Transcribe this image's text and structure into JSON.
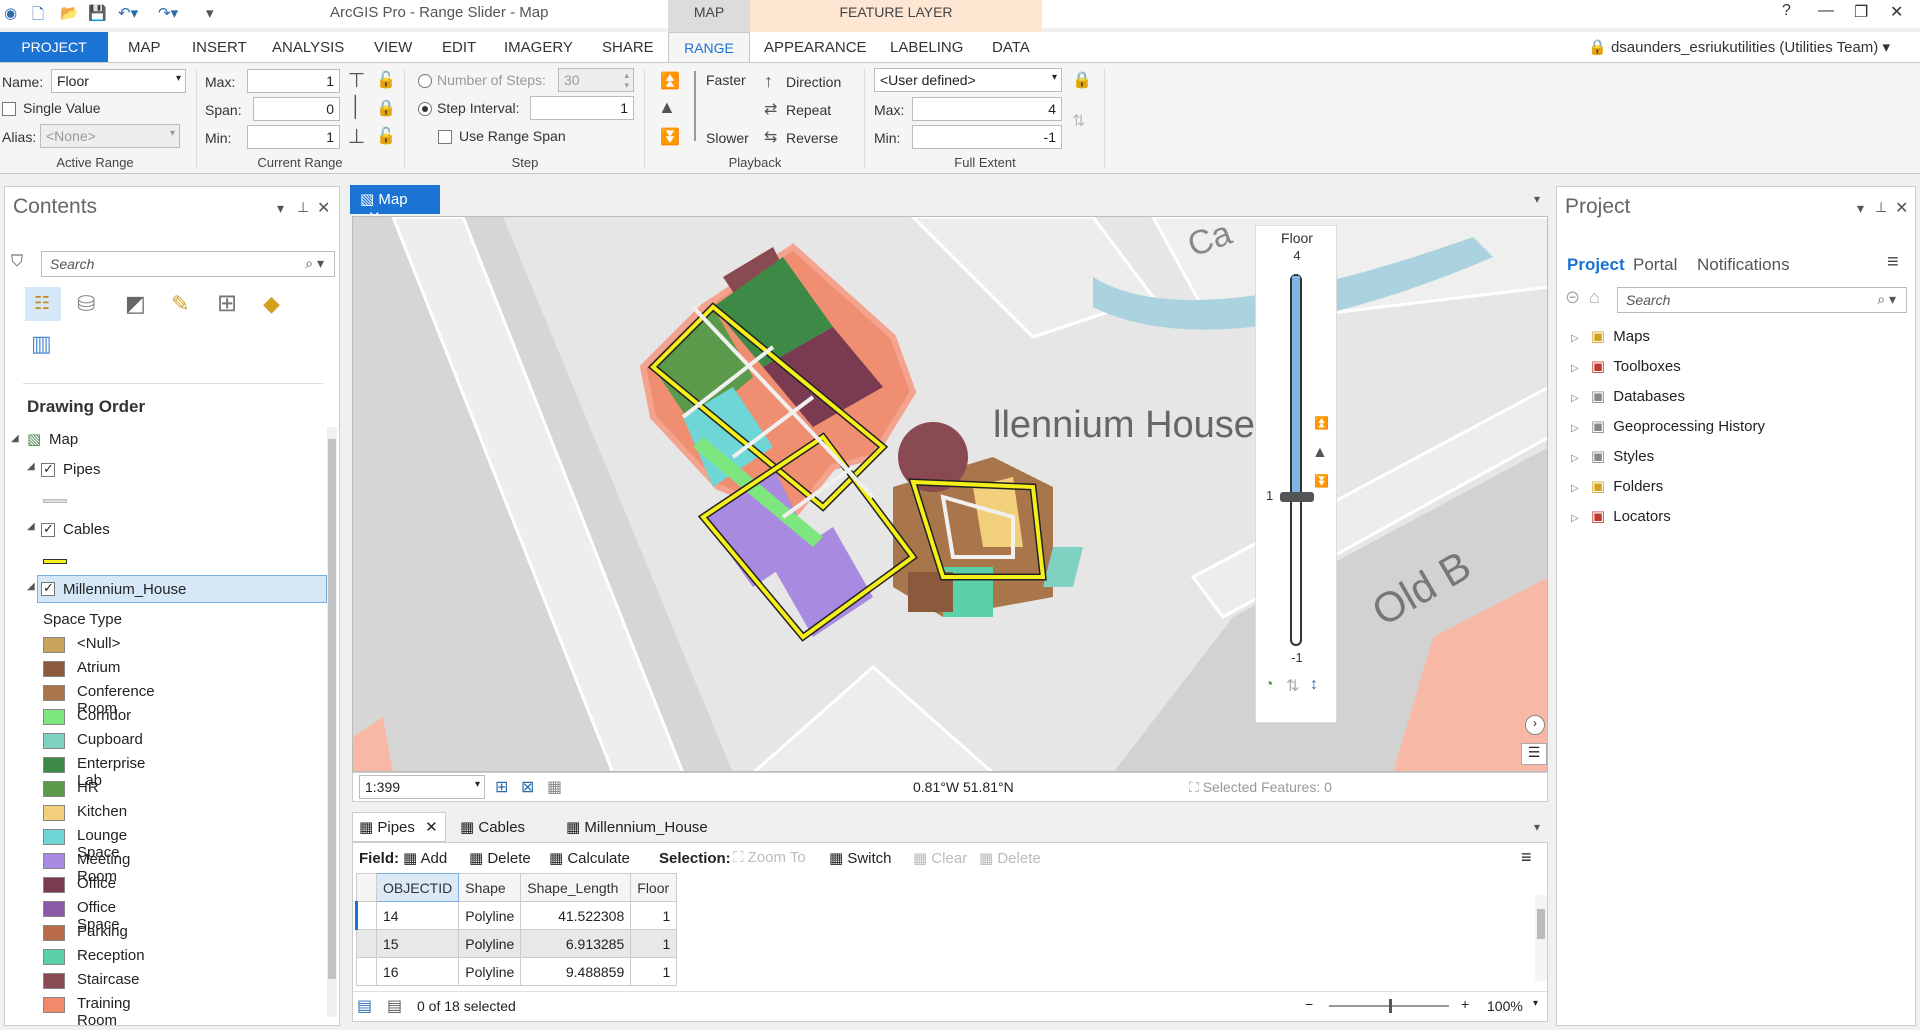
{
  "app": {
    "title": "ArcGIS Pro - Range Slider - Map",
    "context_map": "MAP",
    "context_feature_layer": "FEATURE LAYER",
    "user": "dsaunders_esriukutilities (Utilities Team)"
  },
  "tabs": [
    "PROJECT",
    "MAP",
    "INSERT",
    "ANALYSIS",
    "VIEW",
    "EDIT",
    "IMAGERY",
    "SHARE",
    "RANGE",
    "APPEARANCE",
    "LABELING",
    "DATA"
  ],
  "ribbon": {
    "active_range": {
      "name_label": "Name:",
      "name_value": "Floor",
      "single_value": "Single Value",
      "alias_label": "Alias:",
      "alias_value": "<None>",
      "group": "Active Range"
    },
    "current_range": {
      "max_label": "Max:",
      "max_value": "1",
      "span_label": "Span:",
      "span_value": "0",
      "min_label": "Min:",
      "min_value": "1",
      "group": "Current Range"
    },
    "step": {
      "num_steps_label": "Number of Steps:",
      "num_steps_value": "30",
      "step_interval_label": "Step Interval:",
      "step_interval_value": "1",
      "use_range_span": "Use Range Span",
      "group": "Step"
    },
    "playback": {
      "faster": "Faster",
      "slower": "Slower",
      "direction": "Direction",
      "repeat": "Repeat",
      "reverse": "Reverse",
      "group": "Playback"
    },
    "full_extent": {
      "mode": "<User defined>",
      "max_label": "Max:",
      "max_value": "4",
      "min_label": "Min:",
      "min_value": "-1",
      "group": "Full Extent"
    }
  },
  "contents": {
    "title": "Contents",
    "search_placeholder": "Search",
    "drawing_order": "Drawing Order",
    "layers": {
      "map": "Map",
      "pipes": "Pipes",
      "cables": "Cables",
      "millennium": "Millennium_House"
    },
    "space_type_label": "Space Type",
    "legend": [
      {
        "label": "<Null>",
        "color": "#c8a35a"
      },
      {
        "label": "Atrium",
        "color": "#8b5a3c"
      },
      {
        "label": "Conference Room",
        "color": "#a8764a"
      },
      {
        "label": "Corridor",
        "color": "#7ee67e"
      },
      {
        "label": "Cupboard",
        "color": "#7fd1c1"
      },
      {
        "label": "Enterprise Lab",
        "color": "#3d8a47"
      },
      {
        "label": "HR",
        "color": "#5a9a4a"
      },
      {
        "label": "Kitchen",
        "color": "#f2cf7a"
      },
      {
        "label": "Lounge Space",
        "color": "#6fd6d6"
      },
      {
        "label": "Meeting Room",
        "color": "#a88ae0"
      },
      {
        "label": "Office",
        "color": "#7a3a52"
      },
      {
        "label": "Office Space",
        "color": "#8a5aa8"
      },
      {
        "label": "Parking",
        "color": "#b86a4a"
      },
      {
        "label": "Reception",
        "color": "#5ad1a8"
      },
      {
        "label": "Staircase",
        "color": "#8a4a52"
      },
      {
        "label": "Training Room",
        "color": "#f08a6a"
      }
    ]
  },
  "map": {
    "tab": "Map",
    "label_building": "llennium House",
    "label_street": "Old B",
    "label_top": "Ca",
    "scale": "1:399",
    "coords": "0.81°W 51.81°N",
    "selected_features": "Selected Features: 0"
  },
  "slider": {
    "label": "Floor",
    "max": "4",
    "current": "1",
    "min": "-1",
    "level_fraction": 0.4
  },
  "project_pane": {
    "title": "Project",
    "tabs": [
      "Project",
      "Portal",
      "Notifications"
    ],
    "search_placeholder": "Search",
    "items": [
      "Maps",
      "Toolboxes",
      "Databases",
      "Geoprocessing History",
      "Styles",
      "Folders",
      "Locators"
    ]
  },
  "table": {
    "tabs": [
      "Pipes",
      "Cables",
      "Millennium_House"
    ],
    "field_label": "Field:",
    "add": "Add",
    "delete": "Delete",
    "calculate": "Calculate",
    "selection_label": "Selection:",
    "zoom_to": "Zoom To",
    "switch": "Switch",
    "clear": "Clear",
    "delete2": "Delete",
    "columns": [
      "OBJECTID",
      "Shape",
      "Shape_Length",
      "Floor"
    ],
    "rows": [
      [
        "14",
        "Polyline",
        "41.522308",
        "1"
      ],
      [
        "15",
        "Polyline",
        "6.913285",
        "1"
      ],
      [
        "16",
        "Polyline",
        "9.488859",
        "1"
      ]
    ],
    "status": "0 of 18 selected",
    "zoom": "100%"
  }
}
